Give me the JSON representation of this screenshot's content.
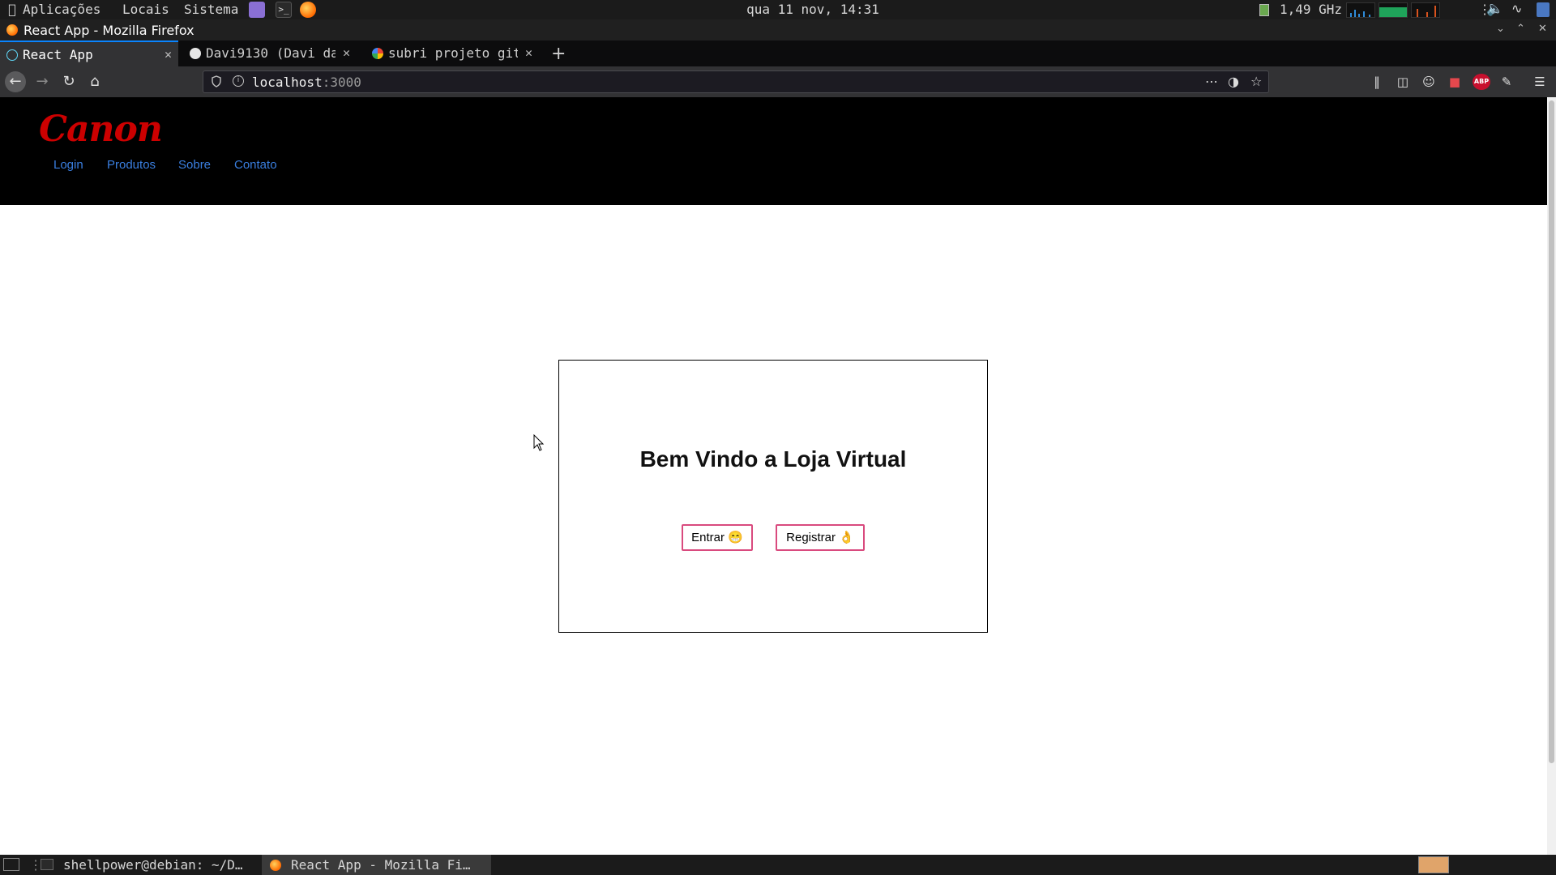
{
  "top_panel": {
    "menus": [
      "Aplicações",
      "Locais",
      "Sistema"
    ],
    "clock": "qua 11 nov, 14:31",
    "cpu_freq": "1,49 GHz"
  },
  "window": {
    "title": "React App - Mozilla Firefox"
  },
  "tabs": [
    {
      "label": "React App",
      "active": true
    },
    {
      "label": "Davi9130 (Davi da",
      "active": false
    },
    {
      "label": "subri projeto git",
      "active": false
    }
  ],
  "url": {
    "host": "localhost",
    "port": ":3000"
  },
  "page": {
    "brand": "Canon",
    "nav": [
      "Login",
      "Produtos",
      "Sobre",
      "Contato"
    ],
    "welcome_title": "Bem Vindo a Loja Virtual",
    "enter_label": "Entrar 😁",
    "register_label": "Registrar 👌"
  },
  "taskbar": {
    "tasks": [
      "shellpower@debian: ~/D…",
      "React App - Mozilla Fi…"
    ]
  },
  "colors": {
    "brand_red": "#cc0000",
    "nav_link_blue": "#3a7fe0",
    "button_border_pink": "#d94a7e",
    "tab_accent": "#0a84ff"
  }
}
